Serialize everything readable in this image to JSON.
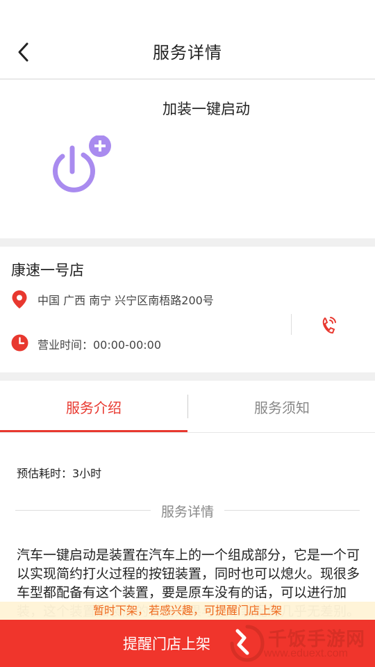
{
  "header": {
    "title": "服务详情"
  },
  "product": {
    "name": "加装一键启动",
    "icon": "power-plus-icon",
    "icon_color": "#a98bef"
  },
  "store": {
    "name": "康速一号店",
    "address": "中国 广西 南宁 兴宁区南梧路200号",
    "hours": "营业时间：00:00-00:00"
  },
  "tabs": [
    {
      "label": "服务介绍",
      "active": true
    },
    {
      "label": "服务须知",
      "active": false
    }
  ],
  "service": {
    "estimated_time": "预估耗时：3小时",
    "detail_heading": "服务详情",
    "description": "汽车一键启动是装置在汽车上的一个组成部分，它是一个可以实现简约打火过程的按钮装置，同时也可以熄火。现很多车型都配备有这个装置，要是原车没有的话，可以进行加装，这个装置加装后的使用效果与原车装配的几乎无差别。"
  },
  "notice": "暂时下架，若感兴趣，可提醒门店上架",
  "cta": {
    "label": "提醒门店上架"
  },
  "watermark": {
    "title": "千饭手游网",
    "url": "www.eduext.com"
  },
  "colors": {
    "accent": "#e8382f",
    "cta": "#f0352c",
    "notice_text": "#ee6a1e",
    "notice_bg": "#fff4d6"
  }
}
